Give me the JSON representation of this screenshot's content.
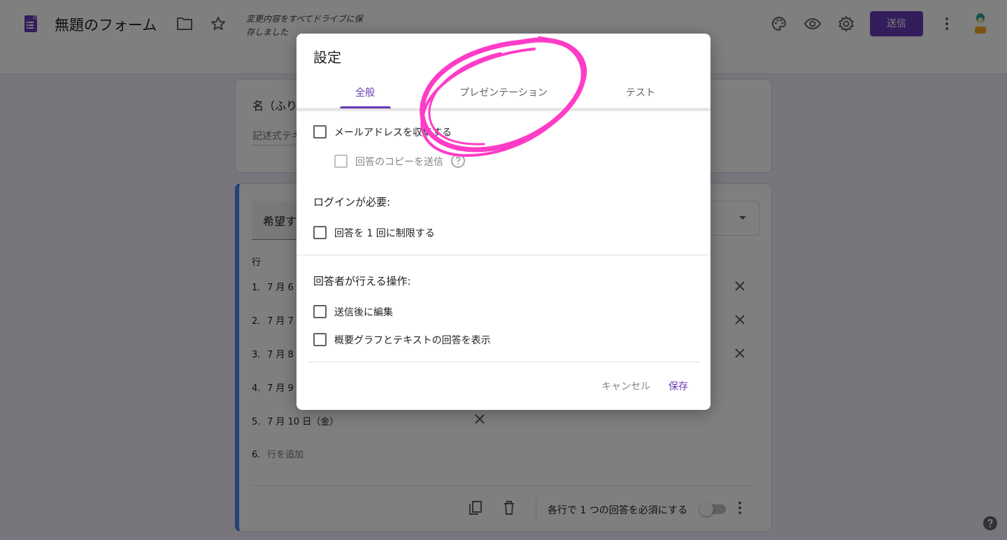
{
  "header": {
    "doc_title": "無題のフォーム",
    "saved_note": "変更内容をすべてドライブに保存しました",
    "send_label": "送信",
    "icons": [
      "palette-icon",
      "preview-icon",
      "settings-icon",
      "more-vert-icon"
    ]
  },
  "form": {
    "q1": {
      "title": "名（ふり",
      "subtitle": "記述式テキ"
    },
    "q2": {
      "title": "希望す",
      "rows_label": "行",
      "rows": [
        {
          "num": "1.",
          "label": "7 月 6"
        },
        {
          "num": "2.",
          "label": "7 月 7"
        },
        {
          "num": "3.",
          "label": "7 月 8"
        },
        {
          "num": "4.",
          "label": "7 月 9"
        },
        {
          "num": "5.",
          "label": "7 月 10 日（金）"
        }
      ],
      "add_row": {
        "num": "6.",
        "label": "行を追加"
      },
      "required_label": "各行で 1 つの回答を必須にする"
    }
  },
  "dialog": {
    "title": "設定",
    "tabs": {
      "general": "全般",
      "presentation": "プレゼンテーション",
      "test": "テスト"
    },
    "options": {
      "collect_email": "メールアドレスを収集する",
      "send_copy": "回答のコピーを送信",
      "login_required": "ログインが必要:",
      "limit_one": "回答を 1 回に制限する",
      "respondents_can": "回答者が行える操作:",
      "edit_after": "送信後に編集",
      "show_summary": "概要グラフとテキストの回答を表示"
    },
    "cancel_label": "キャンセル",
    "save_label": "保存"
  },
  "colors": {
    "brand": "#673ab7",
    "annotation": "#ff3cc7"
  }
}
